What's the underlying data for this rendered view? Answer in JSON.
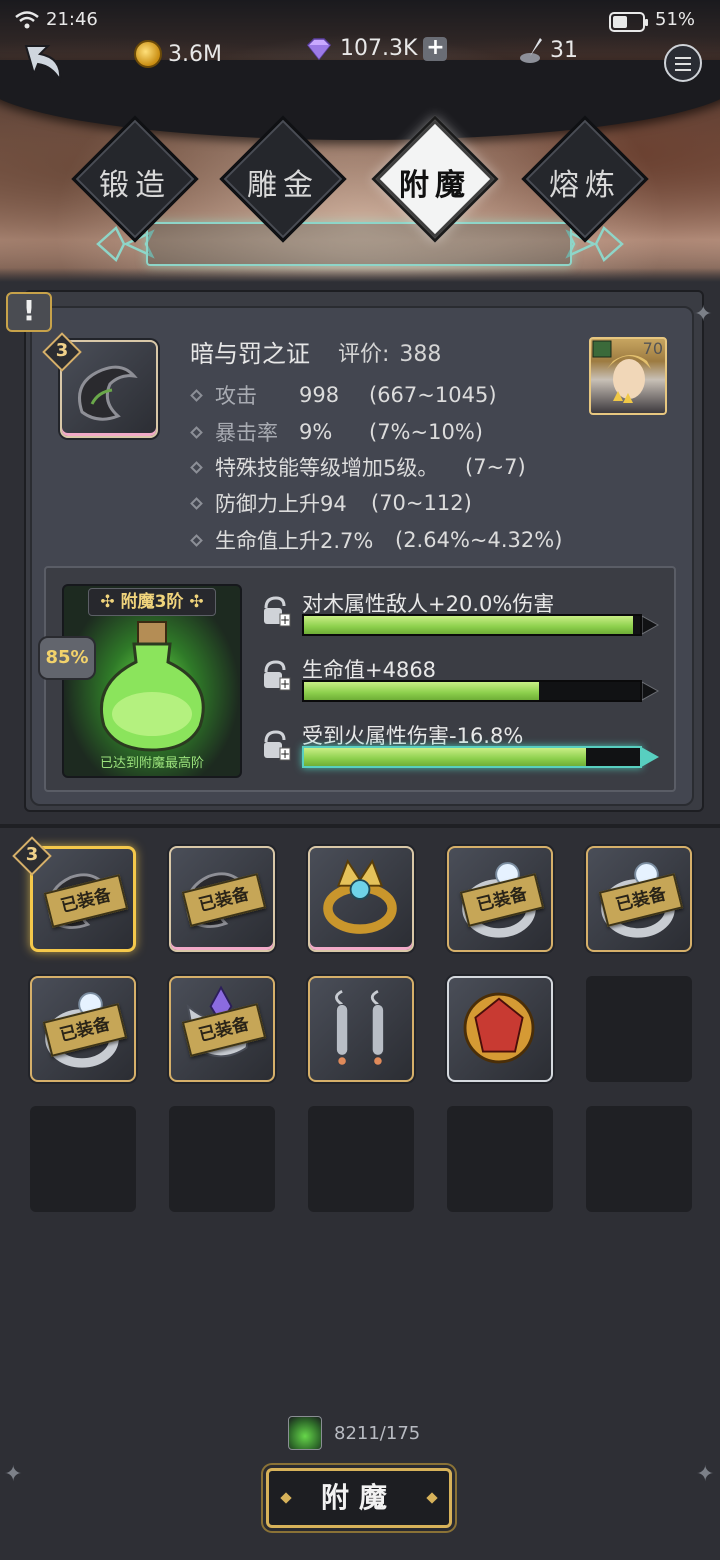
{
  "status": {
    "time": "21:46",
    "battery": "51%",
    "battery_level": 0.51
  },
  "resources": {
    "gold": "3.6M",
    "diamonds": "107.3K",
    "quills": "31"
  },
  "tabs": [
    {
      "label": "锻造",
      "active": false
    },
    {
      "label": "雕金",
      "active": false
    },
    {
      "label": "附魔",
      "active": true
    },
    {
      "label": "熔炼",
      "active": false
    }
  ],
  "item": {
    "name": "暗与罚之证",
    "rating_label": "评价:",
    "rating": "388",
    "level": "3",
    "hero_level": "70",
    "stats": [
      {
        "label": "攻击",
        "value": "998",
        "range": "(667~1045)"
      },
      {
        "label": "暴击率",
        "value": "9%",
        "range": "(7%~10%)"
      },
      {
        "text": "特殊技能等级增加5级。",
        "range": "(7~7)"
      },
      {
        "text": "防御力上升94",
        "range": "(70~112)"
      },
      {
        "text": "生命值上升2.7%",
        "range": "(2.64%~4.32%)"
      }
    ]
  },
  "enchant": {
    "tier_label": "附魔3阶",
    "max_text": "已达到附魔最高阶",
    "percent": "85%",
    "lines": [
      {
        "text": "对木属性敌人+20.0%伤害",
        "fill": 0.98
      },
      {
        "text": "生命值+4868",
        "fill": 0.7
      },
      {
        "text": "受到火属性伤害-16.8%",
        "fill": 0.84
      }
    ]
  },
  "inventory": {
    "equipped_label": "已装备",
    "selected_level": "3",
    "slots": [
      {
        "icon": "dark-horn-relic",
        "equipped": true,
        "selected": true
      },
      {
        "icon": "dark-horn-relic",
        "equipped": true
      },
      {
        "icon": "golden-crown-ring",
        "equipped": false
      },
      {
        "icon": "silver-gem-ring",
        "equipped": true
      },
      {
        "icon": "silver-gem-ring",
        "equipped": true
      },
      {
        "icon": "silver-gem-ring",
        "equipped": true
      },
      {
        "icon": "amethyst-crown",
        "equipped": true
      },
      {
        "icon": "silver-earrings",
        "equipped": false
      },
      {
        "icon": "ruby-amulet",
        "equipped": false
      }
    ]
  },
  "cost": "8211/175",
  "enchant_button": "附魔",
  "colors": {
    "accent_gold": "#d7b25a",
    "bar_green": "#8ccf4c",
    "rail_teal": "#8ed5c8"
  }
}
